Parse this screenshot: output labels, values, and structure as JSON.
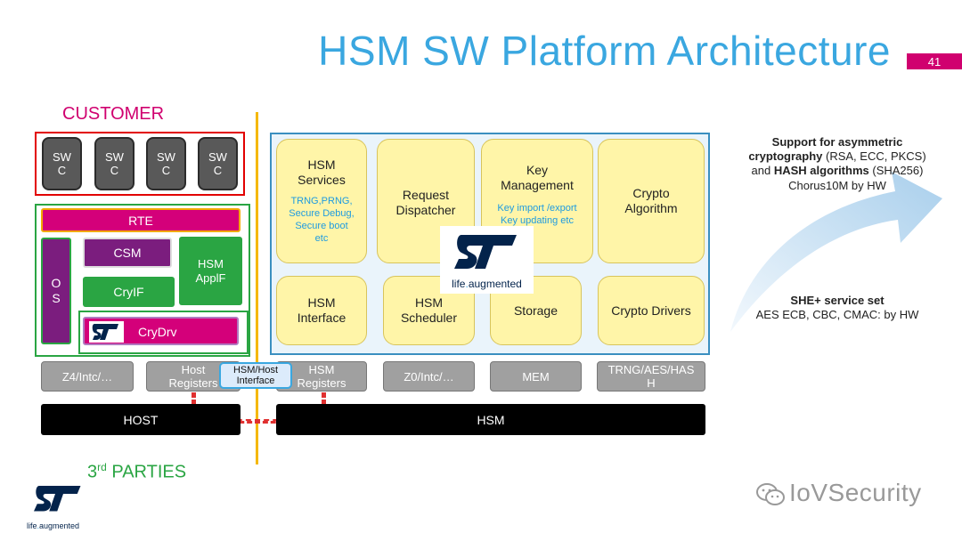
{
  "title": "HSM SW Platform Architecture",
  "page_number": "41",
  "customer_label": "CUSTOMER",
  "third_parties": {
    "prefix": "3",
    "sup": "rd",
    "suffix": " PARTIES"
  },
  "swc_label": [
    "SW",
    "C"
  ],
  "customer_stack": {
    "rte": "RTE",
    "os": [
      "O",
      "S"
    ],
    "csm": "CSM",
    "cryif": "CryIF",
    "hsm_applif": [
      "HSM",
      "ApplF"
    ],
    "crydrv": "CryDrv"
  },
  "hsm_blocks": {
    "services": {
      "title": [
        "HSM",
        "Services"
      ],
      "sub": [
        "TRNG,PRNG,",
        "Secure Debug,",
        "Secure boot",
        "etc"
      ]
    },
    "request_dispatcher": {
      "title": [
        "Request",
        "Dispatcher"
      ]
    },
    "key_management": {
      "title": [
        "Key",
        "Management"
      ],
      "sub": [
        "Key import /export",
        "Key updating etc"
      ]
    },
    "crypto_algorithm": {
      "title": [
        "Crypto",
        "Algorithm"
      ]
    },
    "hsm_interface": {
      "title": [
        "HSM",
        "Interface"
      ]
    },
    "hsm_scheduler": {
      "title": [
        "HSM",
        "Scheduler"
      ]
    },
    "storage": {
      "title": [
        "Storage"
      ]
    },
    "crypto_drivers": {
      "title": [
        "Crypto Drivers"
      ]
    }
  },
  "logo_tagline": {
    "pre": "life",
    "dot": ".",
    "post": "augmented"
  },
  "bottom_blocks": {
    "z4": "Z4/Intc/…",
    "host_registers": [
      "Host",
      "Registers"
    ],
    "hsm_registers": [
      "HSM",
      "Registers"
    ],
    "z0": "Z0/Intc/…",
    "mem": "MEM",
    "trng": [
      "TRNG/AES/HAS",
      "H"
    ]
  },
  "interface_label": [
    "HSM/Host",
    "Interface"
  ],
  "host_bar": "HOST",
  "hsm_bar": "HSM",
  "right_text_1": {
    "line1": "Support for asymmetric",
    "line2_bold": "cryptography",
    "line2_rest": " (RSA, ECC, PKCS)",
    "line3_pre": "and ",
    "line3_bold": "HASH algorithms",
    "line3_rest": " (SHA256)",
    "line4": "Chorus10M by HW"
  },
  "right_text_2": {
    "line1": "SHE+ service set",
    "line2": "AES ECB, CBC, CMAC: by HW"
  },
  "watermark": "IoVSecurity",
  "colors": {
    "title_blue": "#3aa7e0",
    "magenta": "#d0006f",
    "green": "#2aa543",
    "purple": "#7b1d7e",
    "yellow_box": "#fff5a8",
    "st_blue": "#03234b"
  }
}
